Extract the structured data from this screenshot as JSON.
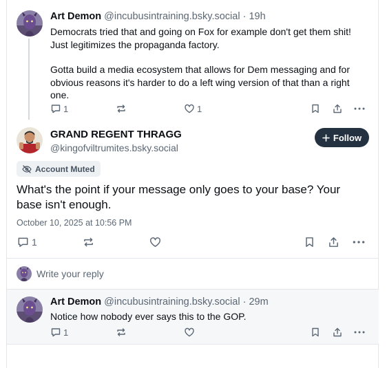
{
  "post1": {
    "author": "Art Demon",
    "handle": "@incubusintraining.bsky.social",
    "time": "· 19h",
    "paragraph1": "Democrats tried that and going on Fox for example don't get them shit! Just legitimizes the propaganda factory.",
    "paragraph2": "Gotta build a media ecosystem that allows for Dem messaging and for obvious reasons it's harder to do a left wing version of that than a right one.",
    "reply_count": "1",
    "like_count": "1"
  },
  "main_post": {
    "author": "GRAND REGENT THRAGG",
    "handle": "@kingofviltrumites.bsky.social",
    "follow_label": "Follow",
    "muted_label": "Account Muted",
    "text": "What's the point if your message only goes to your base? Your base isn't enough.",
    "timestamp": "October 10, 2025 at 10:56 PM",
    "reply_count": "1"
  },
  "reply_prompt": {
    "placeholder": "Write your reply"
  },
  "reply1": {
    "author": "Art Demon",
    "handle": "@incubusintraining.bsky.social",
    "time": "· 29m",
    "text": "Notice how nobody ever says this to the GOP.",
    "reply_count": "1"
  },
  "colors": {
    "accent_dark": "#243140",
    "muted_text": "#5b6774",
    "border": "#e3e6ea"
  }
}
